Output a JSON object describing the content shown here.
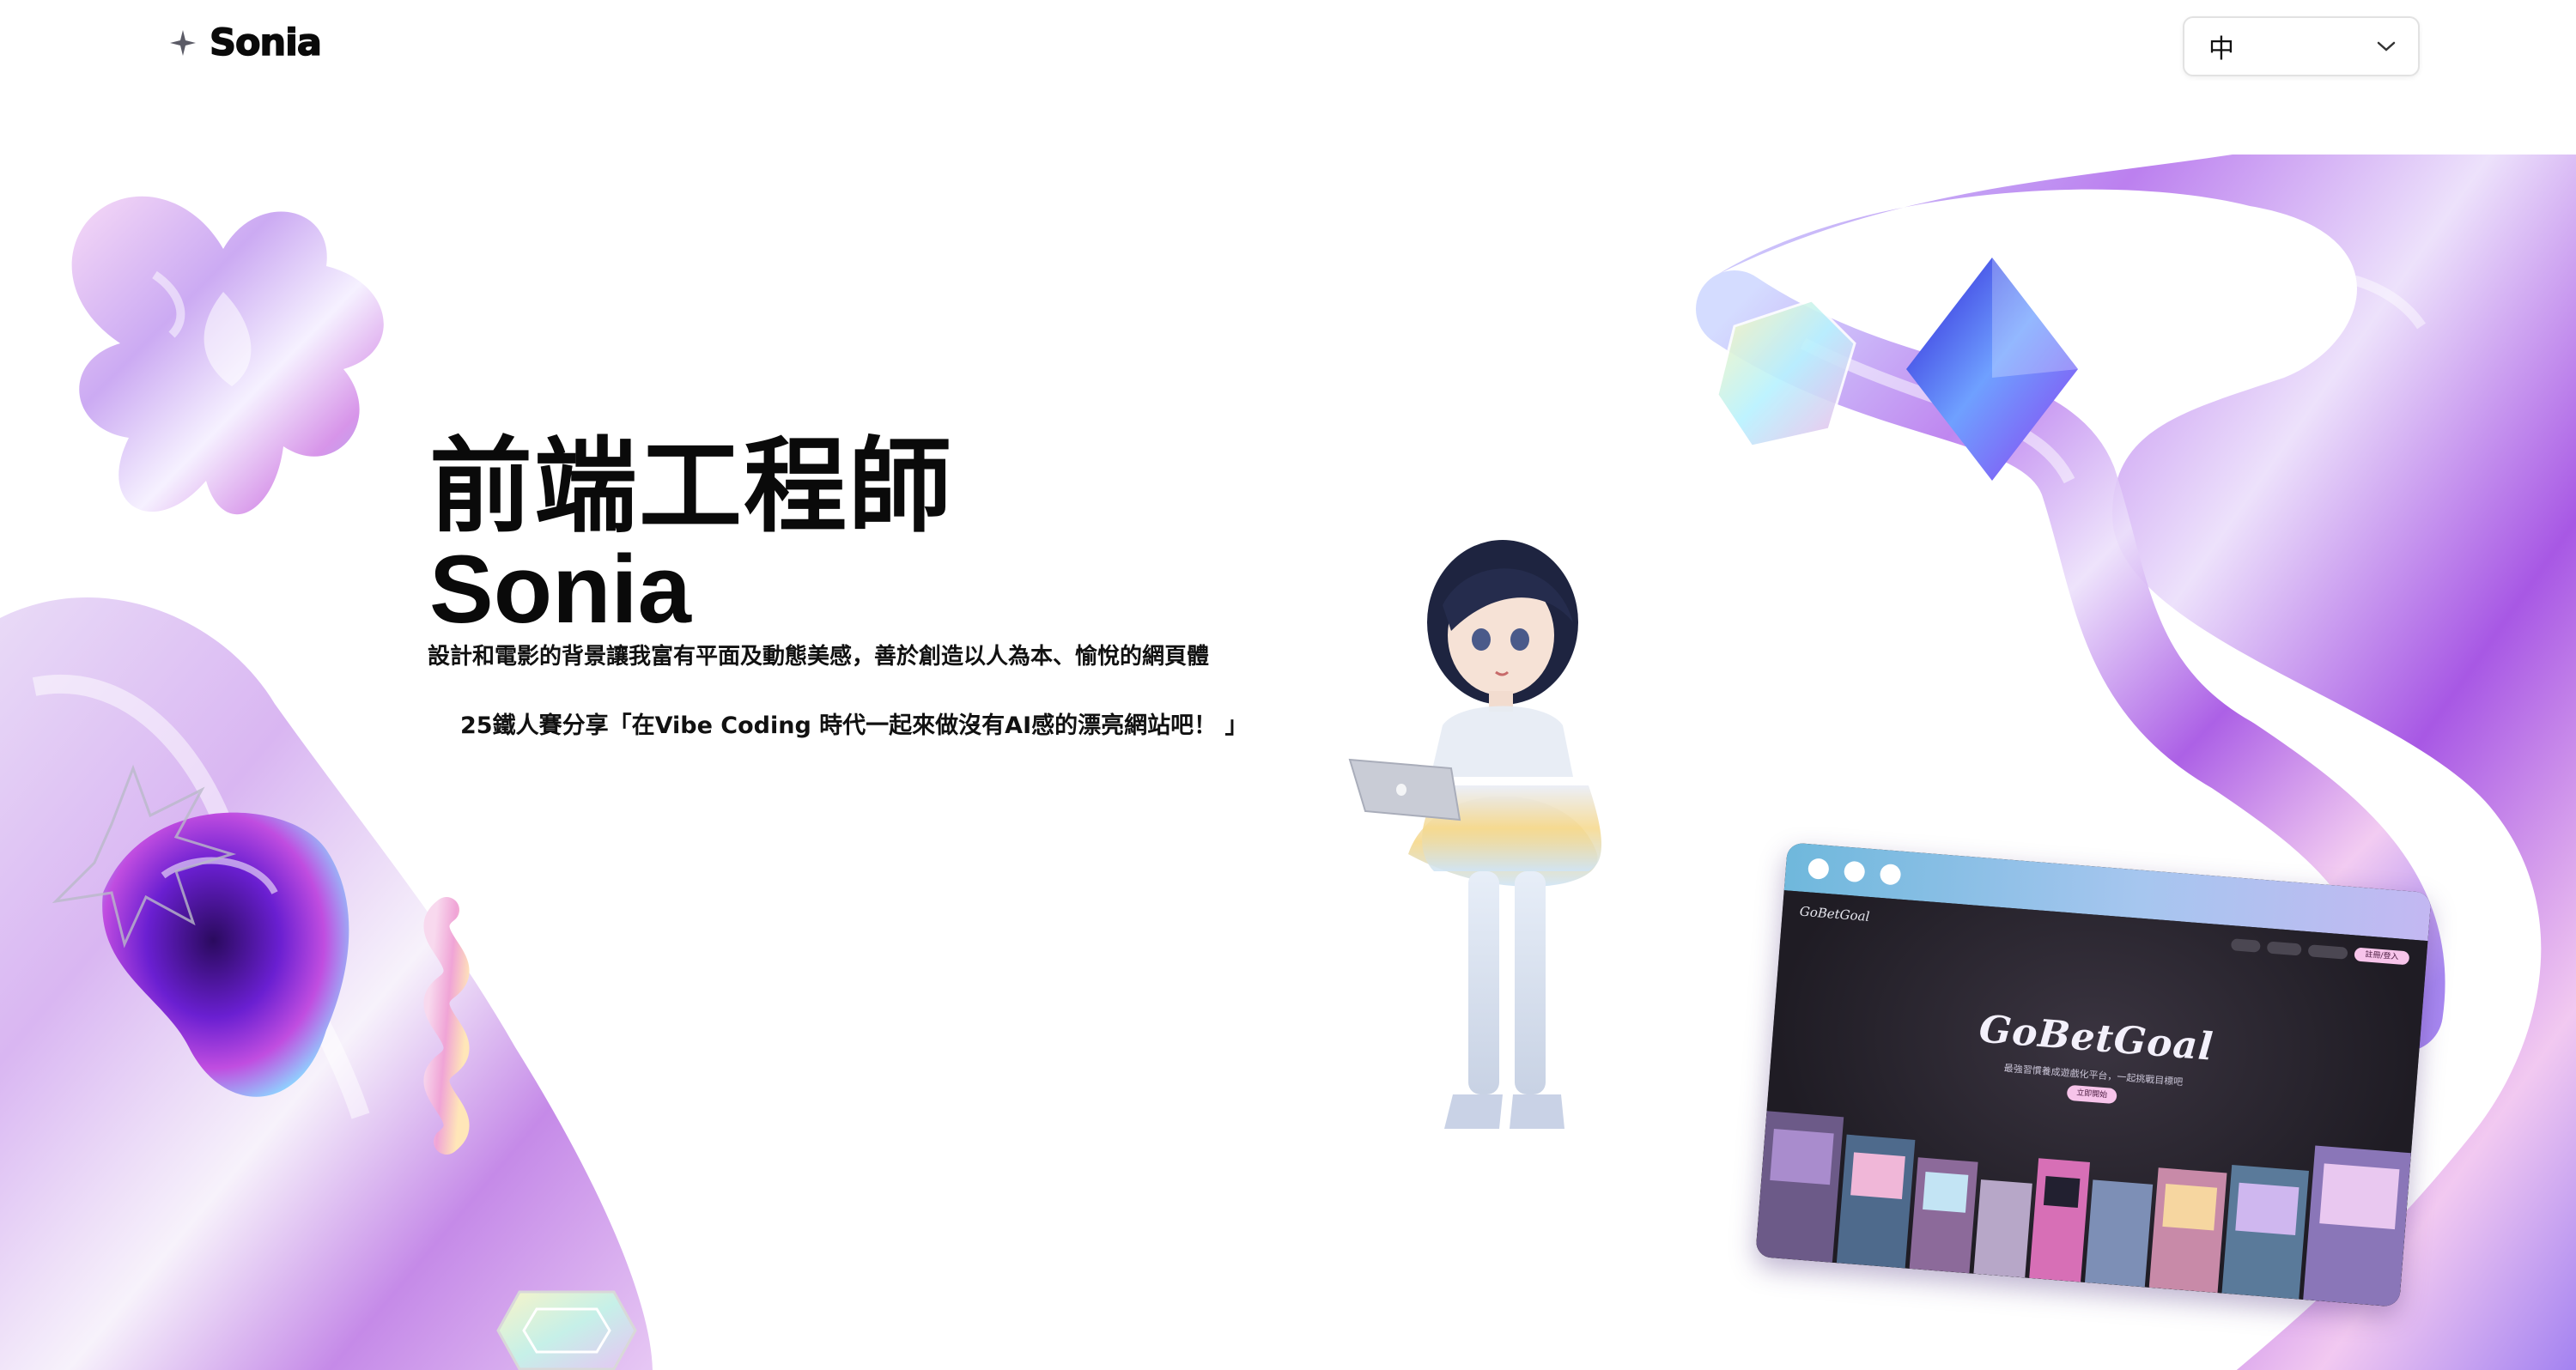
{
  "header": {
    "logo_text": "Sonia",
    "logo_icon": "sparkle-icon",
    "language": {
      "value": "中",
      "icon": "chevron-down-icon"
    }
  },
  "hero": {
    "title": "前端工程師",
    "name": "Sonia",
    "description": "設計和電影的背景讓我富有平面及動態美感，善於創造以人為本、愉悅的網頁體",
    "talk": "25鐵人賽分享「在Vibe Coding 時代一起來做沒有AI感的漂亮網站吧！ 」"
  },
  "showcase": {
    "site_logo": "GoBetGoal",
    "site_title": "GoBetGoal",
    "site_subtitle": "最強習慣養成遊戲化平台，一起挑戰目標吧",
    "site_cta": "立即開始",
    "site_nav_cta": "註冊/登入"
  },
  "colors": {
    "iridescent_purple": "#a06cf0",
    "iridescent_pink": "#f2a6e6",
    "iridescent_blue": "#7fb4f5",
    "browser_bar": "#8fc0ea"
  }
}
